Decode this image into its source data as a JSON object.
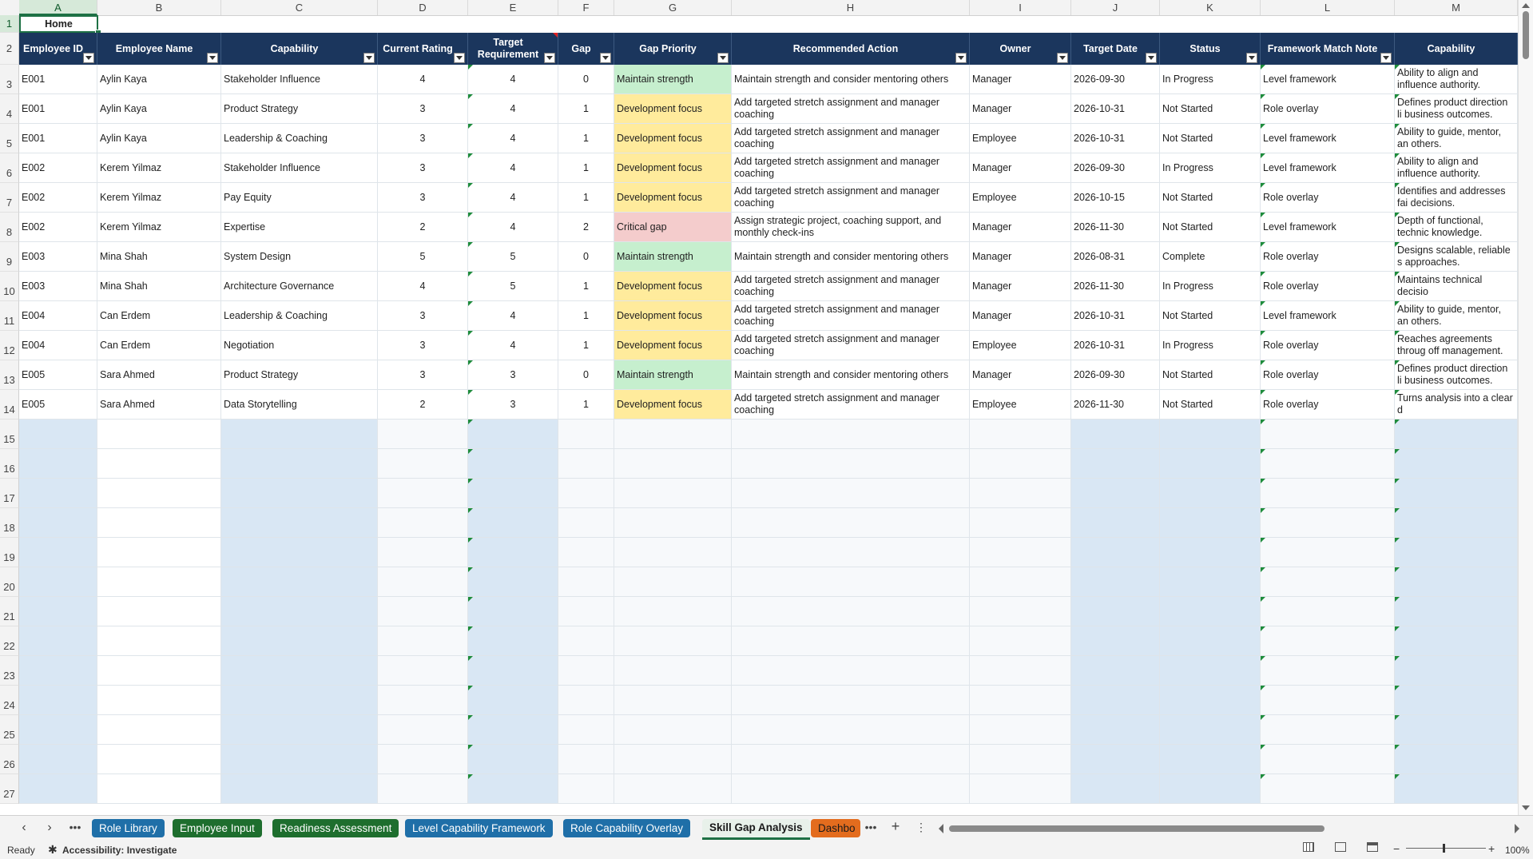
{
  "column_letters": [
    "A",
    "B",
    "C",
    "D",
    "E",
    "F",
    "G",
    "H",
    "I",
    "J",
    "K",
    "L",
    "M"
  ],
  "row_numbers": [
    "1",
    "2",
    "3",
    "4",
    "5",
    "6",
    "7",
    "8",
    "9",
    "10",
    "11",
    "12",
    "13",
    "14",
    "15",
    "16",
    "17",
    "18",
    "19",
    "20",
    "21",
    "22",
    "23",
    "24",
    "25",
    "26",
    "27"
  ],
  "home_cell": "Home",
  "headers": [
    "Employee ID",
    "Employee Name",
    "Capability",
    "Current Rating",
    "Target Requirement",
    "Gap",
    "Gap Priority",
    "Recommended Action",
    "Owner",
    "Target Date",
    "Status",
    "Framework Match Note",
    "Capability"
  ],
  "rows": [
    [
      "E001",
      "Aylin Kaya",
      "Stakeholder Influence",
      "4",
      "4",
      "0",
      "Maintain strength",
      "Maintain strength and consider mentoring others",
      "Manager",
      "2026-09-30",
      "In Progress",
      "Level framework",
      "Ability to align and influence authority."
    ],
    [
      "E001",
      "Aylin Kaya",
      "Product Strategy",
      "3",
      "4",
      "1",
      "Development focus",
      "Add targeted stretch assignment and manager coaching",
      "Manager",
      "2026-10-31",
      "Not Started",
      "Role overlay",
      "Defines product direction li business outcomes."
    ],
    [
      "E001",
      "Aylin Kaya",
      "Leadership & Coaching",
      "3",
      "4",
      "1",
      "Development focus",
      "Add targeted stretch assignment and manager coaching",
      "Employee",
      "2026-10-31",
      "Not Started",
      "Level framework",
      "Ability to guide, mentor, an others."
    ],
    [
      "E002",
      "Kerem Yilmaz",
      "Stakeholder Influence",
      "3",
      "4",
      "1",
      "Development focus",
      "Add targeted stretch assignment and manager coaching",
      "Manager",
      "2026-09-30",
      "In Progress",
      "Level framework",
      "Ability to align and influence authority."
    ],
    [
      "E002",
      "Kerem Yilmaz",
      "Pay Equity",
      "3",
      "4",
      "1",
      "Development focus",
      "Add targeted stretch assignment and manager coaching",
      "Employee",
      "2026-10-15",
      "Not Started",
      "Role overlay",
      "Identifies and addresses fai decisions."
    ],
    [
      "E002",
      "Kerem Yilmaz",
      "Expertise",
      "2",
      "4",
      "2",
      "Critical gap",
      "Assign strategic project, coaching support, and monthly check-ins",
      "Manager",
      "2026-11-30",
      "Not Started",
      "Level framework",
      "Depth of functional, technic knowledge."
    ],
    [
      "E003",
      "Mina Shah",
      "System Design",
      "5",
      "5",
      "0",
      "Maintain strength",
      "Maintain strength and consider mentoring others",
      "Manager",
      "2026-08-31",
      "Complete",
      "Role overlay",
      "Designs scalable, reliable s approaches."
    ],
    [
      "E003",
      "Mina Shah",
      "Architecture Governance",
      "4",
      "5",
      "1",
      "Development focus",
      "Add targeted stretch assignment and manager coaching",
      "Manager",
      "2026-11-30",
      "In Progress",
      "Role overlay",
      "Maintains technical decisio"
    ],
    [
      "E004",
      "Can Erdem",
      "Leadership & Coaching",
      "3",
      "4",
      "1",
      "Development focus",
      "Add targeted stretch assignment and manager coaching",
      "Manager",
      "2026-10-31",
      "Not Started",
      "Level framework",
      "Ability to guide, mentor, an others."
    ],
    [
      "E004",
      "Can Erdem",
      "Negotiation",
      "3",
      "4",
      "1",
      "Development focus",
      "Add targeted stretch assignment and manager coaching",
      "Employee",
      "2026-10-31",
      "In Progress",
      "Role overlay",
      "Reaches agreements throug off management."
    ],
    [
      "E005",
      "Sara Ahmed",
      "Product Strategy",
      "3",
      "3",
      "0",
      "Maintain strength",
      "Maintain strength and consider mentoring others",
      "Manager",
      "2026-09-30",
      "Not Started",
      "Role overlay",
      "Defines product direction li business outcomes."
    ],
    [
      "E005",
      "Sara Ahmed",
      "Data Storytelling",
      "2",
      "3",
      "1",
      "Development focus",
      "Add targeted stretch assignment and manager coaching",
      "Employee",
      "2026-11-30",
      "Not Started",
      "Role overlay",
      "Turns analysis into a clear d"
    ]
  ],
  "priority_colors": {
    "Maintain strength": "#c6efce",
    "Development focus": "#ffeb9c",
    "Critical gap": "#f4cccc"
  },
  "header_color": "#1b365d",
  "tabs": [
    {
      "label": "Role Library",
      "color": "#1f6fa8"
    },
    {
      "label": "Employee Input",
      "color": "#1e6e2e"
    },
    {
      "label": "Readiness Assessment",
      "color": "#1e6e2e"
    },
    {
      "label": "Level Capability Framework",
      "color": "#1f6fa8"
    },
    {
      "label": "Role Capability Overlay",
      "color": "#1f6fa8"
    },
    {
      "label": "Skill Gap Analysis",
      "color": "#e8f1ea",
      "active": true
    },
    {
      "label": "Dashbo",
      "color": "#e36c1e"
    }
  ],
  "status": {
    "ready": "Ready",
    "accessibility": "Accessibility: Investigate",
    "zoom": "100%"
  }
}
